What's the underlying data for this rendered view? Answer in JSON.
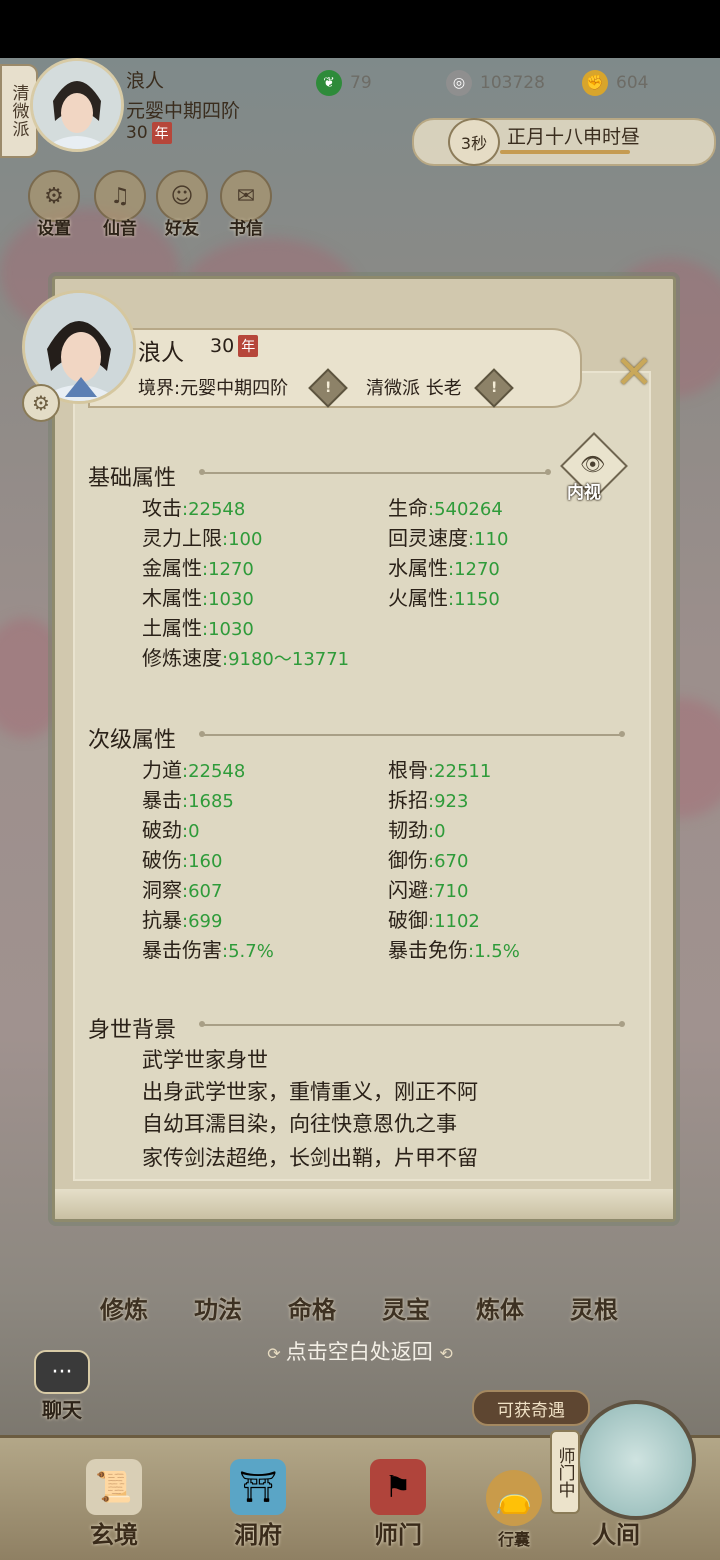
{
  "top": {
    "sect": "清微派",
    "name": "浪人",
    "realm": "元婴中期四阶",
    "age": "30",
    "year_badge": "年",
    "resources": [
      {
        "name": "jade",
        "value": "79",
        "icon": "jade-leaf-icon",
        "color": "#2e8b3a"
      },
      {
        "name": "coins",
        "value": "103728",
        "icon": "coin-icon",
        "color": "#777777"
      },
      {
        "name": "strength",
        "value": "604",
        "icon": "muscle-icon",
        "color": "#d8a52c"
      }
    ],
    "timer_seconds": "3秒",
    "calendar": "正月十八申时昼"
  },
  "quick_menu": [
    {
      "label": "设置",
      "icon": "settings-icon"
    },
    {
      "label": "仙音",
      "icon": "music-scroll-icon"
    },
    {
      "label": "好友",
      "icon": "friends-icon"
    },
    {
      "label": "书信",
      "icon": "letter-icon"
    }
  ],
  "modal": {
    "name": "浪人",
    "age": "30",
    "year_badge": "年",
    "realm": "境界:元婴中期四阶",
    "sect": "清微派 长老",
    "innerview_label": "内视",
    "basic": {
      "title": "基础属性",
      "stats": [
        {
          "label": "攻击",
          "value": ":22548"
        },
        {
          "label": "生命",
          "value": ":540264"
        },
        {
          "label": "灵力上限",
          "value": ":100"
        },
        {
          "label": "回灵速度",
          "value": ":110"
        },
        {
          "label": "金属性",
          "value": ":1270"
        },
        {
          "label": "水属性",
          "value": ":1270"
        },
        {
          "label": "木属性",
          "value": ":1030"
        },
        {
          "label": "火属性",
          "value": ":1150"
        },
        {
          "label": "土属性",
          "value": ":1030"
        },
        {
          "label": "修炼速度",
          "value": ":9180～13771"
        }
      ]
    },
    "secondary": {
      "title": "次级属性",
      "stats": [
        {
          "label": "力道",
          "value": ":22548"
        },
        {
          "label": "根骨",
          "value": ":22511"
        },
        {
          "label": "暴击",
          "value": ":1685"
        },
        {
          "label": "拆招",
          "value": ":923"
        },
        {
          "label": "破劲",
          "value": ":0"
        },
        {
          "label": "韧劲",
          "value": ":0"
        },
        {
          "label": "破伤",
          "value": ":160"
        },
        {
          "label": "御伤",
          "value": ":670"
        },
        {
          "label": "洞察",
          "value": ":607"
        },
        {
          "label": "闪避",
          "value": ":710"
        },
        {
          "label": "抗暴",
          "value": ":699"
        },
        {
          "label": "破御",
          "value": ":1102"
        },
        {
          "label": "暴击伤害",
          "value": ":5.7%"
        },
        {
          "label": "暴击免伤",
          "value": ":1.5%"
        }
      ]
    },
    "background": {
      "title": "身世背景",
      "lines": [
        "武学世家身世",
        "出身武学世家，重情重义，刚正不阿",
        "自幼耳濡目染，向往快意恩仇之事",
        "家传剑法超绝，长剑出鞘，片甲不留"
      ]
    }
  },
  "under_tabs": [
    "修炼",
    "功法",
    "命格",
    "灵宝",
    "炼体",
    "灵根"
  ],
  "return_hint": "点击空白处返回",
  "chat_label": "聊天",
  "encounter_label": "可获奇遇",
  "master_label": "师门中",
  "nav": [
    {
      "label": "玄境",
      "icon": "scroll-icon"
    },
    {
      "label": "洞府",
      "icon": "pavilion-icon"
    },
    {
      "label": "师门",
      "icon": "banner-icon"
    },
    {
      "label": "行囊",
      "icon": "bag-icon"
    },
    {
      "label": "人间",
      "icon": "mountain-icon"
    }
  ]
}
